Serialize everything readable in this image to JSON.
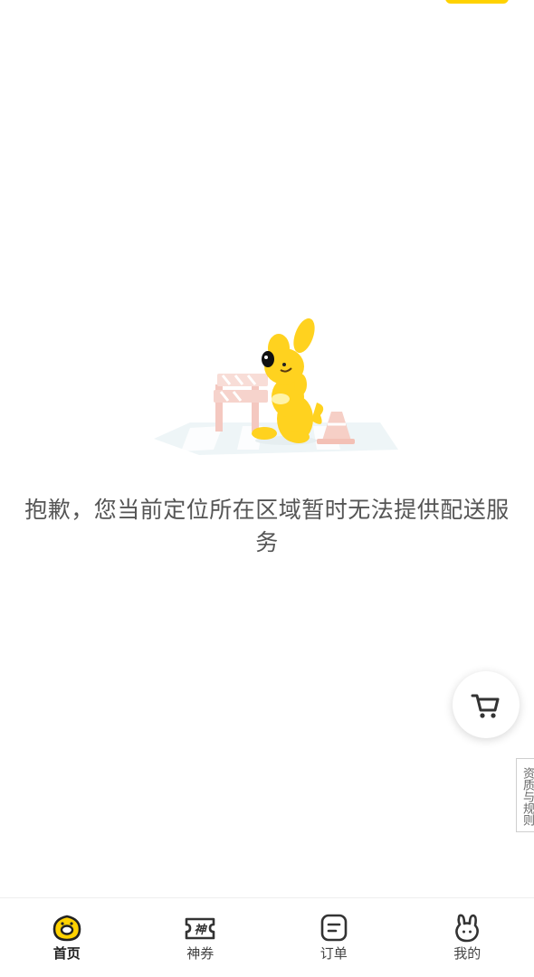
{
  "empty_state": {
    "message": "抱歉，您当前定位所在区域暂时无法提供配送服务"
  },
  "side_tab": {
    "label": "资质与规则"
  },
  "cart": {
    "icon": "cart-icon"
  },
  "tabbar": {
    "items": [
      {
        "label": "首页",
        "icon": "home-icon",
        "active": true
      },
      {
        "label": "神券",
        "icon": "coupon-icon",
        "active": false
      },
      {
        "label": "订单",
        "icon": "order-icon",
        "active": false
      },
      {
        "label": "我的",
        "icon": "profile-icon",
        "active": false
      }
    ]
  },
  "colors": {
    "brand_yellow": "#ffd200",
    "text_gray": "#555555",
    "icon_dark": "#333333"
  }
}
